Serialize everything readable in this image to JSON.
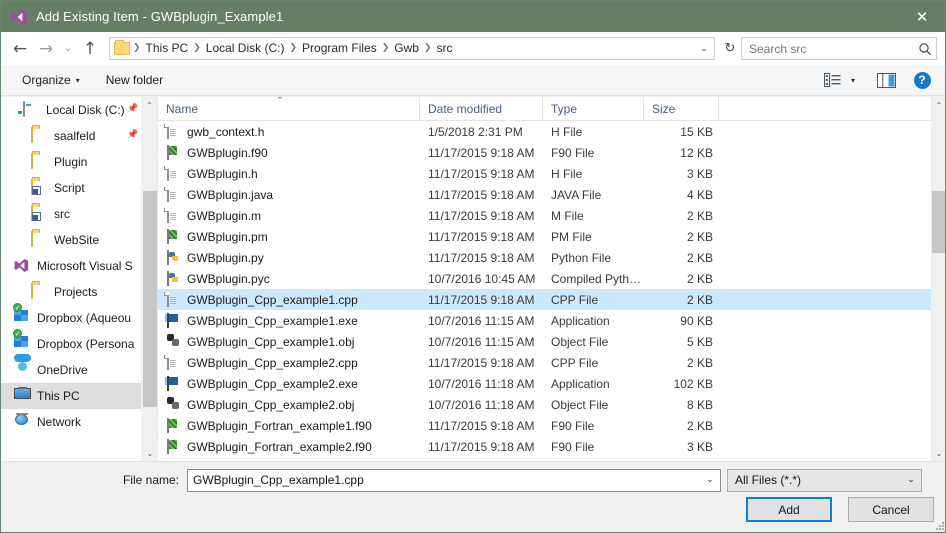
{
  "window": {
    "title": "Add Existing Item - GWBplugin_Example1",
    "app_icon": "visual-studio-icon",
    "close_label": "✕"
  },
  "nav": {
    "back_label": "←",
    "forward_label": "→",
    "history_label": "⌄",
    "up_label": "↑",
    "dropdown_label": "⌄",
    "refresh_label": "↻",
    "breadcrumbs": [
      "This PC",
      "Local Disk (C:)",
      "Program Files",
      "Gwb",
      "src"
    ],
    "separator": "❯"
  },
  "search": {
    "placeholder": "Search src",
    "icon": "search-icon"
  },
  "commandbar": {
    "organize_label": "Organize",
    "organize_caret": "▾",
    "new_folder_label": "New folder",
    "view_caret": "▾",
    "help_label": "?"
  },
  "sidebar": {
    "scroll_up": "⌃",
    "scroll_down": "⌄",
    "items": [
      {
        "label": "Local Disk (C:)",
        "icon": "drive-icon",
        "indent": 22,
        "pinned": true,
        "selected": false
      },
      {
        "label": "saalfeld",
        "icon": "folder-icon",
        "indent": 30,
        "pinned": true,
        "selected": false
      },
      {
        "label": "Plugin",
        "icon": "folder-icon",
        "indent": 30,
        "pinned": false,
        "selected": false
      },
      {
        "label": "Script",
        "icon": "folder-shortcut-icon",
        "indent": 30,
        "pinned": false,
        "selected": false
      },
      {
        "label": "src",
        "icon": "folder-shortcut-icon",
        "indent": 30,
        "pinned": false,
        "selected": false
      },
      {
        "label": "WebSite",
        "icon": "folder-icon",
        "indent": 30,
        "pinned": false,
        "selected": false
      },
      {
        "label": "Microsoft Visual S",
        "icon": "visual-studio-icon",
        "indent": 13,
        "pinned": false,
        "selected": false
      },
      {
        "label": "Projects",
        "icon": "folder-icon",
        "indent": 30,
        "pinned": false,
        "selected": false
      },
      {
        "label": "Dropbox (Aqueou",
        "icon": "dropbox-icon",
        "indent": 13,
        "pinned": false,
        "selected": false
      },
      {
        "label": "Dropbox (Persona",
        "icon": "dropbox-icon",
        "indent": 13,
        "pinned": false,
        "selected": false
      },
      {
        "label": "OneDrive",
        "icon": "cloud-icon",
        "indent": 13,
        "pinned": false,
        "selected": false
      },
      {
        "label": "This PC",
        "icon": "this-pc-icon",
        "indent": 13,
        "pinned": false,
        "selected": true
      },
      {
        "label": "Network",
        "icon": "network-icon",
        "indent": 13,
        "pinned": false,
        "selected": false
      }
    ]
  },
  "filelist": {
    "columns": [
      "Name",
      "Date modified",
      "Type",
      "Size"
    ],
    "sort_column": "Name",
    "sort_direction": "ascending",
    "sort_indicator": "⌃",
    "rows": [
      {
        "name": "gwb_context.h",
        "date": "1/5/2018 2:31 PM",
        "type": "H File",
        "size": "15 KB",
        "icon": "document-file-icon",
        "selected": false
      },
      {
        "name": "GWBplugin.f90",
        "date": "11/17/2015 9:18 AM",
        "type": "F90 File",
        "size": "12 KB",
        "icon": "fortran-file-icon",
        "selected": false
      },
      {
        "name": "GWBplugin.h",
        "date": "11/17/2015 9:18 AM",
        "type": "H File",
        "size": "3 KB",
        "icon": "document-file-icon",
        "selected": false
      },
      {
        "name": "GWBplugin.java",
        "date": "11/17/2015 9:18 AM",
        "type": "JAVA File",
        "size": "4 KB",
        "icon": "document-file-icon",
        "selected": false
      },
      {
        "name": "GWBplugin.m",
        "date": "11/17/2015 9:18 AM",
        "type": "M File",
        "size": "2 KB",
        "icon": "document-file-icon",
        "selected": false
      },
      {
        "name": "GWBplugin.pm",
        "date": "11/17/2015 9:18 AM",
        "type": "PM File",
        "size": "2 KB",
        "icon": "fortran-file-icon",
        "selected": false
      },
      {
        "name": "GWBplugin.py",
        "date": "11/17/2015 9:18 AM",
        "type": "Python File",
        "size": "2 KB",
        "icon": "python-file-icon",
        "selected": false
      },
      {
        "name": "GWBplugin.pyc",
        "date": "10/7/2016 10:45 AM",
        "type": "Compiled Python ...",
        "size": "2 KB",
        "icon": "python-file-icon",
        "selected": false
      },
      {
        "name": "GWBplugin_Cpp_example1.cpp",
        "date": "11/17/2015 9:18 AM",
        "type": "CPP File",
        "size": "2 KB",
        "icon": "document-file-icon",
        "selected": true
      },
      {
        "name": "GWBplugin_Cpp_example1.exe",
        "date": "10/7/2016 11:15 AM",
        "type": "Application",
        "size": "90 KB",
        "icon": "application-icon",
        "selected": false
      },
      {
        "name": "GWBplugin_Cpp_example1.obj",
        "date": "10/7/2016 11:15 AM",
        "type": "Object File",
        "size": "5 KB",
        "icon": "object-file-icon",
        "selected": false
      },
      {
        "name": "GWBplugin_Cpp_example2.cpp",
        "date": "11/17/2015 9:18 AM",
        "type": "CPP File",
        "size": "2 KB",
        "icon": "document-file-icon",
        "selected": false
      },
      {
        "name": "GWBplugin_Cpp_example2.exe",
        "date": "10/7/2016 11:18 AM",
        "type": "Application",
        "size": "102 KB",
        "icon": "application-icon",
        "selected": false
      },
      {
        "name": "GWBplugin_Cpp_example2.obj",
        "date": "10/7/2016 11:18 AM",
        "type": "Object File",
        "size": "8 KB",
        "icon": "object-file-icon",
        "selected": false
      },
      {
        "name": "GWBplugin_Fortran_example1.f90",
        "date": "11/17/2015 9:18 AM",
        "type": "F90 File",
        "size": "2 KB",
        "icon": "fortran-file-icon",
        "selected": false
      },
      {
        "name": "GWBplugin_Fortran_example2.f90",
        "date": "11/17/2015 9:18 AM",
        "type": "F90 File",
        "size": "3 KB",
        "icon": "fortran-file-icon",
        "selected": false
      }
    ],
    "scroll_up": "⌃",
    "scroll_down": "⌄"
  },
  "bottom": {
    "filename_label": "File name:",
    "filename_value": "GWBplugin_Cpp_example1.cpp",
    "filename_caret": "⌄",
    "filter_value": "All Files (*.*)",
    "filter_caret": "⌄",
    "add_label": "Add",
    "cancel_label": "Cancel"
  },
  "colors": {
    "titlebar": "#647f66",
    "selection": "#cce8fc",
    "default_button_border": "#0a7fd8",
    "accent_blue": "#1878c8",
    "column_header_text": "#4a5f7a"
  }
}
